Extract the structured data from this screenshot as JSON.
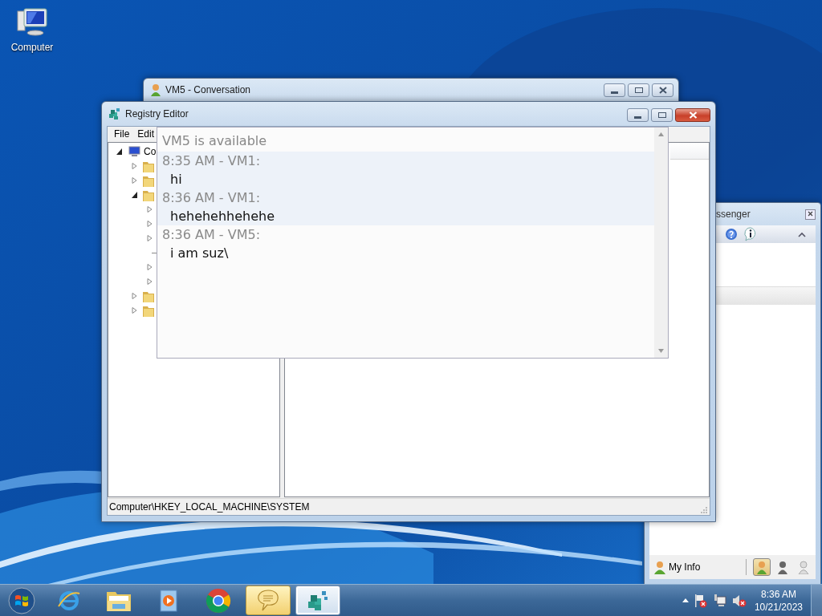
{
  "desktop": {
    "icons": [
      {
        "label": "Computer"
      }
    ]
  },
  "conversation_window": {
    "title": "VM5 - Conversation",
    "chat": {
      "status": "VM5 is available",
      "messages": [
        {
          "kind": "sent",
          "header": "8:35 AM - VM1:",
          "text": "hi"
        },
        {
          "kind": "sent",
          "header": "8:36 AM - VM1:",
          "text": "hehehehhehehe"
        },
        {
          "kind": "received",
          "header": "8:36 AM - VM5:",
          "text": "i am suz\\"
        }
      ]
    }
  },
  "registry_editor": {
    "title": "Registry Editor",
    "menu": [
      "File",
      "Edit"
    ],
    "tree": [
      {
        "kind": "computer",
        "label": "Co",
        "expanded": true,
        "children": [
          {
            "kind": "folder",
            "expanded": false
          },
          {
            "kind": "folder",
            "expanded": false
          },
          {
            "kind": "folder",
            "expanded": true,
            "children": [
              {
                "kind": "hidden",
                "expanded": false
              },
              {
                "kind": "hidden",
                "expanded": false
              },
              {
                "kind": "hidden",
                "expanded": false
              },
              {
                "kind": "leaf"
              },
              {
                "kind": "hidden",
                "expanded": false
              },
              {
                "kind": "hidden",
                "expanded": false
              }
            ]
          },
          {
            "kind": "folder",
            "expanded": false
          },
          {
            "kind": "folder",
            "expanded": false
          }
        ]
      }
    ],
    "status_bar": "Computer\\HKEY_LOCAL_MACHINE\\SYSTEM"
  },
  "messenger_window": {
    "title": "ssenger",
    "my_info": "My Info",
    "statuses": [
      {
        "kind": "available",
        "selected": true
      },
      {
        "kind": "busy",
        "selected": false
      },
      {
        "kind": "offline",
        "selected": false
      }
    ]
  },
  "taskbar": {
    "apps": [
      {
        "kind": "browser-e",
        "selected": false,
        "flashing": false
      },
      {
        "kind": "folder",
        "selected": false,
        "flashing": false
      },
      {
        "kind": "media",
        "selected": false,
        "flashing": false
      },
      {
        "kind": "chrome",
        "selected": false,
        "flashing": false
      },
      {
        "kind": "chat",
        "selected": false,
        "flashing": true
      },
      {
        "kind": "registry",
        "selected": true,
        "flashing": false
      }
    ],
    "clock": {
      "time": "8:36 AM",
      "date": "10/21/2023"
    }
  }
}
